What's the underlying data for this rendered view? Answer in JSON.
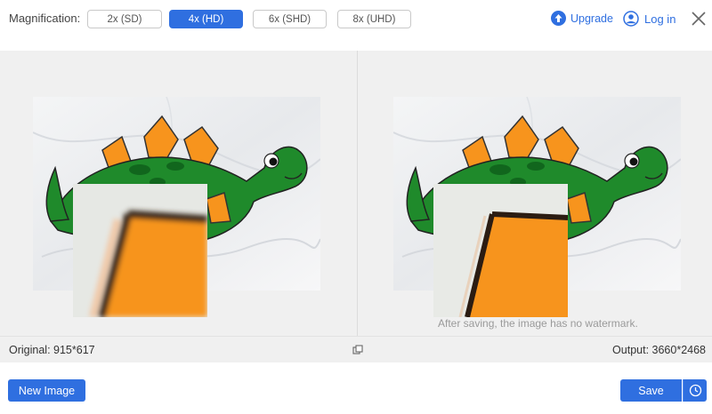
{
  "header": {
    "magnification_label": "Magnification:",
    "options": [
      {
        "label": "2x (SD)",
        "selected": false
      },
      {
        "label": "4x (HD)",
        "selected": true
      },
      {
        "label": "6x (SHD)",
        "selected": false
      },
      {
        "label": "8x (UHD)",
        "selected": false
      }
    ],
    "upgrade_label": "Upgrade",
    "login_label": "Log in"
  },
  "preview": {
    "watermark_note": "After saving, the image has no watermark."
  },
  "info": {
    "original": "Original: 915*617",
    "output": "Output: 3660*2468"
  },
  "footer": {
    "new_image_label": "New Image",
    "save_label": "Save"
  },
  "colors": {
    "accent": "#2f6fe0",
    "dino_green": "#1f8a2b",
    "dino_orange": "#f7941d"
  }
}
